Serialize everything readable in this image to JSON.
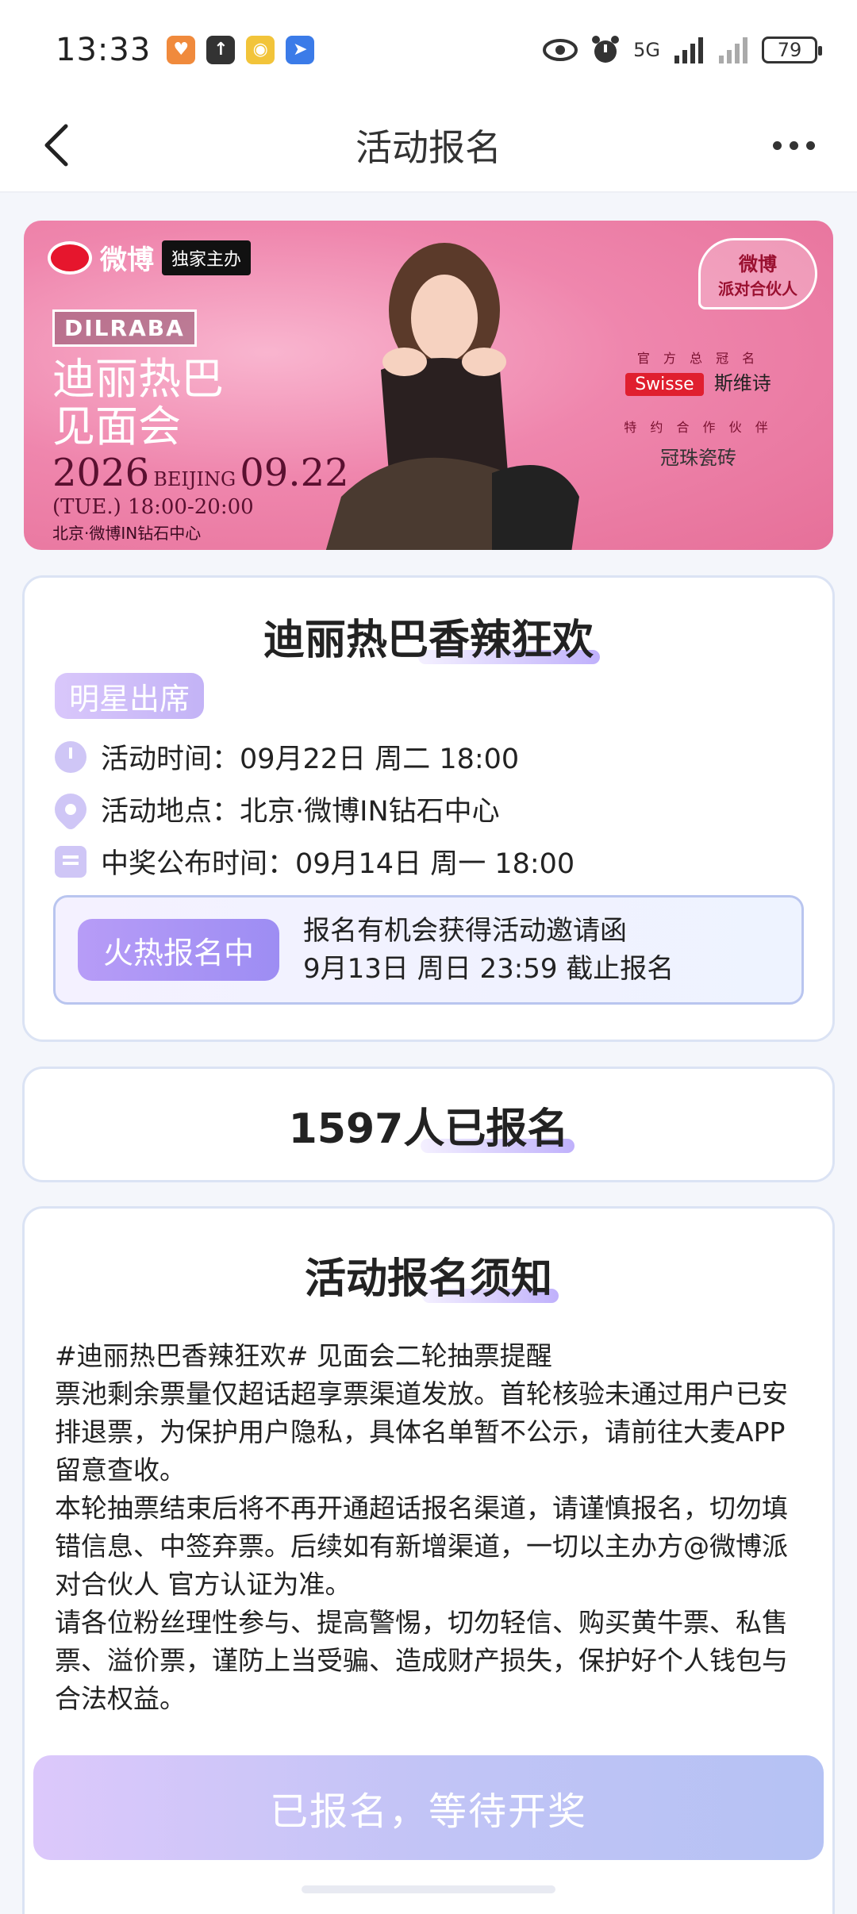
{
  "status_bar": {
    "time": "13:33",
    "battery": "79",
    "network": "5G"
  },
  "nav": {
    "title": "活动报名"
  },
  "banner": {
    "weibo": "微博",
    "exclusive": "独家主办",
    "tag": "DILRABA",
    "title_line1": "迪丽热巴",
    "title_line2": "见面会",
    "year": "2026",
    "date": "09.22",
    "time": "(TUE.) 18:00-20:00",
    "city": "BEIJING",
    "location": "北京·微博IN钻石中心",
    "badge_line1": "微博",
    "badge_line2": "派对合伙人",
    "sponsor_caption": "官 方 总 冠 名",
    "sponsor_brand": "Swisse",
    "sponsor_brand_cn": "斯维诗",
    "partner_caption": "特 约 合 作 伙 伴",
    "partner": "冠珠瓷砖"
  },
  "event": {
    "title": "迪丽热巴香辣狂欢",
    "star_tag": "明星出席",
    "time_label": "活动时间：09月22日 周二 18:00",
    "place_label": "活动地点：北京·微博IN钻石中心",
    "result_label": "中奖公布时间：09月14日 周一 18:00",
    "hot_button": "火热报名中",
    "signup_line1": "报名有机会获得活动邀请函",
    "signup_line2": "9月13日 周日 23:59 截止报名"
  },
  "registrations": {
    "count_text": "1597人已报名"
  },
  "notice": {
    "title": "活动报名须知",
    "p1": "#迪丽热巴香辣狂欢# 见面会二轮抽票提醒",
    "p2": "票池剩余票量仅超话超享票渠道发放。首轮核验未通过用户已安排退票，为保护用户隐私，具体名单暂不公示，请前往大麦APP留意查收。",
    "p3": "本轮抽票结束后将不再开通超话报名渠道，请谨慎报名，切勿填错信息、中签弃票。后续如有新增渠道，一切以主办方@微博派对合伙人 官方认证为准。",
    "p4": "请各位粉丝理性参与、提高警惕，切勿轻信、购买黄牛票、私售票、溢价票，谨防上当受骗、造成财产损失，保护好个人钱包与合法权益。"
  },
  "bottom_button": {
    "label": "已报名，等待开奖"
  },
  "colors": {
    "accent": "#9d8df3",
    "banner_pink": "#ef86ad",
    "card_border": "#dbe3f4"
  }
}
